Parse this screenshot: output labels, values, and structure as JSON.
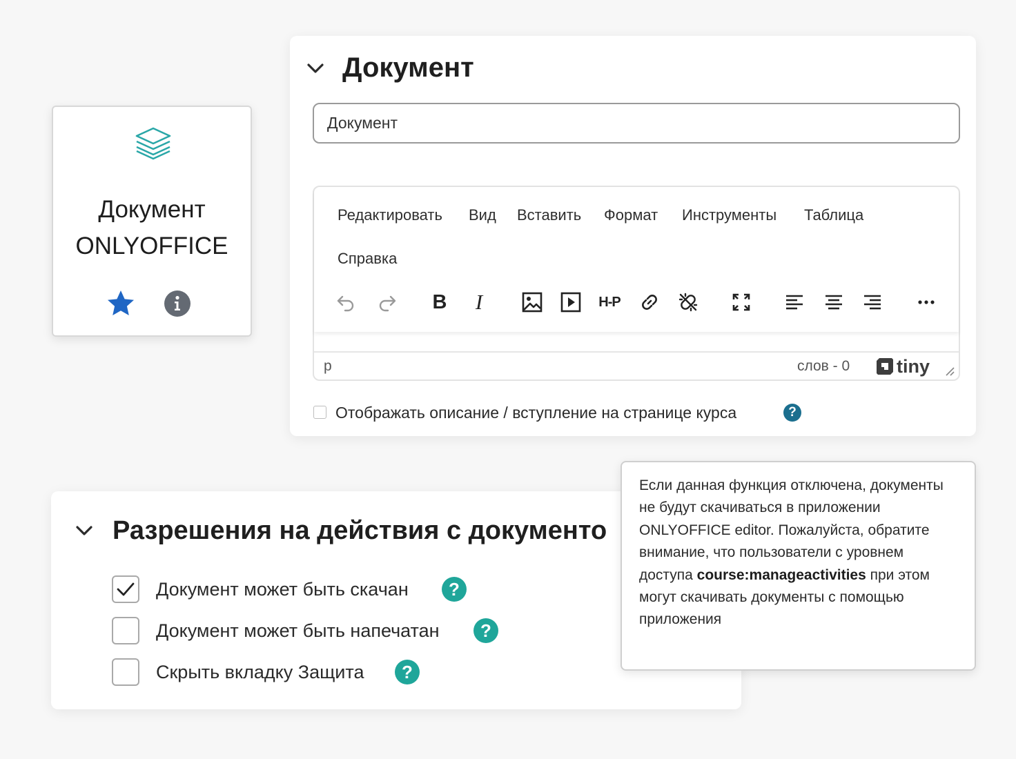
{
  "activity_card": {
    "title_line1": "Документ",
    "title_line2": "ONLYOFFICE",
    "icons": {
      "main": "layers-icon",
      "favourite": "star-icon",
      "info": "info-icon"
    },
    "colors": {
      "layers": "#2aa7a8",
      "star": "#1f66c4",
      "info": "#646a73"
    }
  },
  "document_section": {
    "title": "Документ",
    "name_input": {
      "value": "Документ",
      "placeholder": ""
    },
    "editor": {
      "menu": [
        "Редактировать",
        "Вид",
        "Вставить",
        "Формат",
        "Инструменты",
        "Таблица",
        "Справка"
      ],
      "toolbar": {
        "bold": "B",
        "italic": "I",
        "h5p": "H-P",
        "icons": [
          "undo-icon",
          "redo-icon",
          "bold-icon",
          "italic-icon",
          "image-icon",
          "media-icon",
          "h5p-icon",
          "link-icon",
          "unlink-icon",
          "fullscreen-icon",
          "align-left-icon",
          "align-center-icon",
          "align-right-icon",
          "more-icon"
        ]
      },
      "status": {
        "path": "p",
        "word_count": "слов - 0",
        "brand": "tiny"
      }
    },
    "show_description": {
      "label": "Отображать описание / вступление на странице курса",
      "checked": false,
      "help": "?"
    }
  },
  "permissions_section": {
    "title": "Разрешения на действия с документо",
    "items": [
      {
        "label": "Документ может быть скачан",
        "checked": true,
        "help": "?"
      },
      {
        "label": "Документ может быть напечатан",
        "checked": false,
        "help": "?"
      },
      {
        "label": "Скрыть вкладку Защита",
        "checked": false,
        "help": "?"
      }
    ]
  },
  "tooltip": {
    "text_before": "Если данная функция отключена, документы не будут скачиваться в приложении ONLYOFFICE editor. Пожалуйста, обратите внимание, что пользователи с уровнем доступа ",
    "bold": "course:manageactivities",
    "text_after": " при этом могут скачивать документы с помощью приложения"
  },
  "colors": {
    "background": "#f7f7f7",
    "help_blue": "#1b6f8f",
    "help_teal": "#1fa69a",
    "text": "#2c2c2c"
  }
}
